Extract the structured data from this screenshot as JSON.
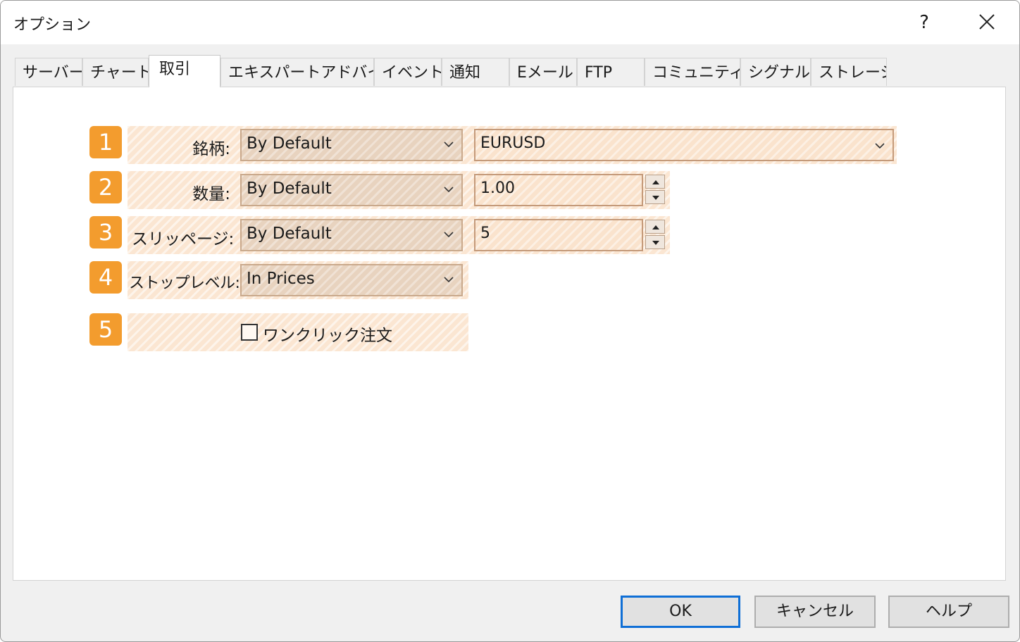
{
  "window": {
    "title": "オプション",
    "help_label": "?"
  },
  "tabs": [
    {
      "label": "サーバー"
    },
    {
      "label": "チャート"
    },
    {
      "label": "取引",
      "active": true
    },
    {
      "label": "エキスパートアドバイザ"
    },
    {
      "label": "イベント"
    },
    {
      "label": "通知"
    },
    {
      "label": "Eメール"
    },
    {
      "label": "FTP"
    },
    {
      "label": "コミュニティー"
    },
    {
      "label": "シグナル"
    },
    {
      "label": "ストレージ"
    }
  ],
  "rows": [
    {
      "badge": "1",
      "label": "銘柄:",
      "combo_value": "By Default",
      "second_value": "EURUSD",
      "second_type": "dropdown"
    },
    {
      "badge": "2",
      "label": "数量:",
      "combo_value": "By Default",
      "second_value": "1.00",
      "second_type": "spinner"
    },
    {
      "badge": "3",
      "label": "スリッページ:",
      "combo_value": "By Default",
      "second_value": "5",
      "second_type": "spinner"
    },
    {
      "badge": "4",
      "label": "ストップレベル:",
      "combo_value": "In Prices"
    },
    {
      "badge": "5",
      "checkbox_label": "ワンクリック注文",
      "checked": false
    }
  ],
  "buttons": {
    "ok": "OK",
    "cancel": "キャンセル",
    "help": "ヘルプ"
  },
  "colors": {
    "badge": "#f39c2e",
    "highlight": "#fbe6d2",
    "default_button_border": "#0f6fd6"
  },
  "icons": {
    "combo_arrow": "chevron-down-icon",
    "spin_up": "triangle-up-icon",
    "spin_down": "triangle-down-icon",
    "close": "close-icon"
  }
}
